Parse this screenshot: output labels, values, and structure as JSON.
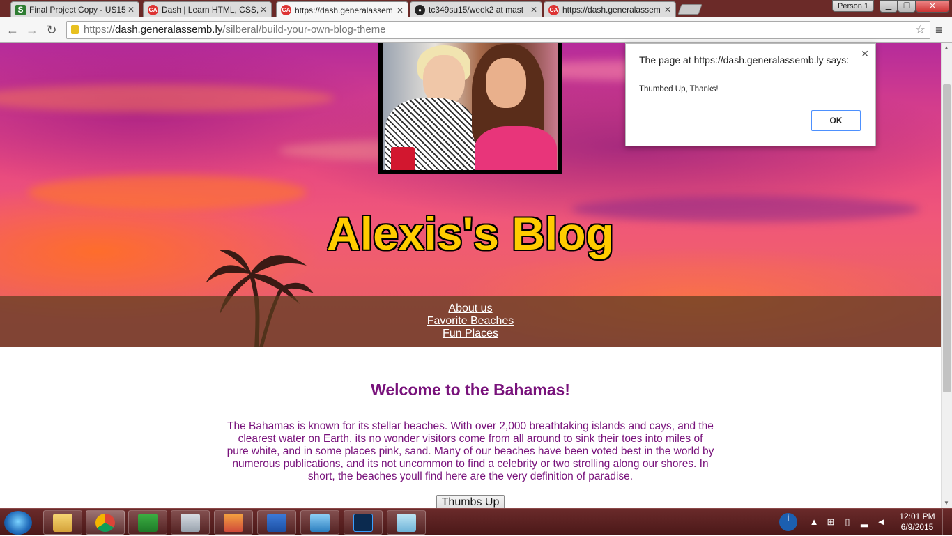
{
  "browser": {
    "tabs": [
      {
        "title": "Final Project Copy - US15",
        "icon": "sheets-icon"
      },
      {
        "title": "Dash | Learn HTML, CSS, J",
        "icon": "ga-icon"
      },
      {
        "title": "https://dash.generalassem",
        "icon": "ga-icon",
        "active": true
      },
      {
        "title": "tc349su15/week2 at mast",
        "icon": "github-icon"
      },
      {
        "title": "https://dash.generalassem",
        "icon": "ga-icon"
      }
    ],
    "profile_label": "Person 1",
    "url_host": "dash.generalassemb.ly",
    "url_scheme": "https://",
    "url_path": "/silberal/build-your-own-blog-theme"
  },
  "blog": {
    "title": "Alexis's Blog",
    "nav": [
      "About us",
      "Favorite Beaches",
      "Fun Places"
    ],
    "heading": "Welcome to the Bahamas!",
    "body": "The Bahamas is known for its stellar beaches. With over 2,000 breathtaking islands and cays, and the clearest water on Earth, its no wonder visitors come from all around to sink their toes into miles of pure white, and in some places pink, sand. Many of our beaches have been voted best in the world by numerous publications, and its not uncommon to find a celebrity or two strolling along our shores. In short, the beaches youll find here are the very definition of paradise.",
    "thumbs_button": "Thumbs Up"
  },
  "alert": {
    "title": "The page at https://dash.generalassemb.ly says:",
    "message": "Thumbed Up, Thanks!",
    "ok": "OK"
  },
  "taskbar": {
    "apps": [
      "explorer-icon",
      "chrome-icon",
      "hp-icon",
      "calculator-icon",
      "paint-icon",
      "word-icon",
      "photo-viewer-icon",
      "photoshop-icon",
      "notepad-icon"
    ],
    "time": "12:01 PM",
    "date": "6/9/2015"
  },
  "colors": {
    "title_yellow": "#ffcc00",
    "content_purple": "#78127b",
    "nav_strip": "#5a3c1e"
  }
}
